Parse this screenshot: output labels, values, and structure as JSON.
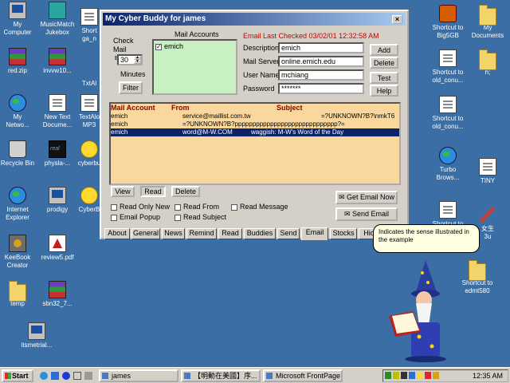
{
  "desktop": {
    "icons": [
      {
        "label": "My\nComputer",
        "icon": "computer-icon"
      },
      {
        "label": "MusicMatch\nJukebox",
        "icon": "musicmatch-icon"
      },
      {
        "label": "Short\nga_n",
        "icon": "shortcut-icon"
      },
      {
        "label": "red.zip",
        "icon": "rar-archive-icon"
      },
      {
        "label": "invvw10...",
        "icon": "rar-archive-icon"
      },
      {
        "label": "TxtAl",
        "icon": "document-icon"
      },
      {
        "label": "My\nNetwo...",
        "icon": "network-icon"
      },
      {
        "label": "New Text\nDocume...",
        "icon": "text-document-icon"
      },
      {
        "label": "TextAlo\nMP3",
        "icon": "mp3-icon"
      },
      {
        "label": "Recycle Bin",
        "icon": "recycle-bin-icon"
      },
      {
        "label": "physla-...",
        "icon": "real-player-icon"
      },
      {
        "label": "cyberbu",
        "icon": "cyberbuddy-icon"
      },
      {
        "label": "Internet\nExplorer",
        "icon": "internet-explorer-icon"
      },
      {
        "label": "prodigy",
        "icon": "prodigy-icon"
      },
      {
        "label": "CyberB",
        "icon": "cyberbuddy-icon"
      },
      {
        "label": "KeeBook\nCreator",
        "icon": "keebook-icon"
      },
      {
        "label": "review5.pdf",
        "icon": "pdf-icon"
      },
      {
        "label": "temp",
        "icon": "folder-icon"
      },
      {
        "label": "sbn32_7...",
        "icon": "rar-archive-icon"
      },
      {
        "label": "itsmetrial...",
        "icon": "setup-icon"
      },
      {
        "label": "Shortcut to\nBig5GB",
        "icon": "shortcut-icon"
      },
      {
        "label": "My\nDocuments",
        "icon": "folder-icon"
      },
      {
        "label": "Shortcut to\nold_conu...",
        "icon": "shortcut-icon"
      },
      {
        "label": "h;",
        "icon": "folder-icon"
      },
      {
        "label": "Shortcut to\nold_conu...",
        "icon": "shortcut-icon"
      },
      {
        "label": "Turbo\nBrows...",
        "icon": "turbo-browser-icon"
      },
      {
        "label": "TINY",
        "icon": "tiny-icon"
      },
      {
        "label": "Shortcut to",
        "icon": "shortcut-icon"
      },
      {
        "label": "女生\n3u",
        "icon": "pencil-icon"
      },
      {
        "label": "Shortcut to\nedmt580",
        "icon": "folder-icon"
      }
    ]
  },
  "window": {
    "title": "My Cyber Buddy for james",
    "close": "×",
    "check_mail_label": "Check\nMail",
    "every_label": "E",
    "minutes_value": "30",
    "minutes_label": "Minutes",
    "filter_button": "Filter",
    "mail_accounts_header": "Mail Accounts",
    "mail_accounts": [
      {
        "name": "emich",
        "checked": true
      }
    ],
    "last_checked": "Email Last Checked 03/02/01 12:32:58 AM",
    "fields": {
      "description": {
        "label": "Description",
        "value": "emich"
      },
      "mail_server": {
        "label": "Mail Server",
        "value": "online.emich.edu"
      },
      "user_name": {
        "label": "User Name",
        "value": "mchiang"
      },
      "password": {
        "label": "Password",
        "value": "*******"
      }
    },
    "buttons": {
      "add": "Add",
      "delete": "Delete",
      "test": "Test",
      "help": "Help"
    },
    "list": {
      "columns": [
        "Mail Account",
        "From",
        "Subject"
      ],
      "rows": [
        {
          "account": "emich",
          "from": "service@maillist.com.tw",
          "subject": "=?UNKNOWN?B?\\nmkT6",
          "selected": false
        },
        {
          "account": "emich",
          "from": "=?UNKNOWN?B?ppppppppppppppppppppppppppppp?=",
          "subject": "",
          "selected": false
        },
        {
          "account": "emich",
          "from": "word@M-W.COM",
          "subject": "waggish: M-W's Word of the Day",
          "selected": true
        }
      ]
    },
    "list_buttons": {
      "view": "View",
      "read": "Read",
      "delete": "Delete"
    },
    "options": [
      {
        "label": "Read Only New",
        "checked": false
      },
      {
        "label": "Read From",
        "checked": false
      },
      {
        "label": "Read Message",
        "checked": false
      },
      {
        "label": "Email Popup",
        "checked": false
      },
      {
        "label": "Read Subject",
        "checked": false
      }
    ],
    "get_email_button": "Get Email Now",
    "send_email_button": "Send Email",
    "tabs": [
      "About",
      "General",
      "News",
      "Remind",
      "Read",
      "Buddies",
      "Send",
      "Email",
      "Stocks",
      "Hid"
    ],
    "active_tab": "Email"
  },
  "tooltip": {
    "text": "Indicates the sense illustrated in the example"
  },
  "taskbar": {
    "start_label": "Start",
    "tasks": [
      {
        "label": "james",
        "active": false
      },
      {
        "label": "【明動在美國】序...",
        "active": false
      },
      {
        "label": "Microsoft FrontPage",
        "active": false
      }
    ],
    "clock": "12:35 AM"
  },
  "colors": {
    "desktop": "#3a6ea5",
    "title_bar": "#0a246a",
    "mail_list_bg": "#fad79c",
    "mail_accounts_bg": "#c8f0c0",
    "last_checked_text": "#cc0000"
  }
}
